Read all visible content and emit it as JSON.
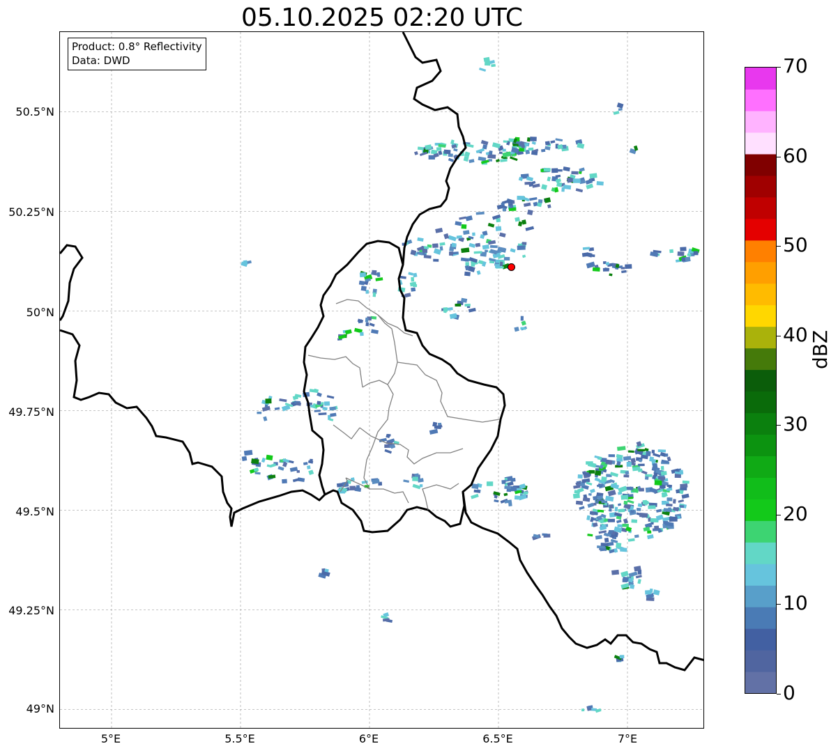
{
  "title": "05.10.2025 02:20 UTC",
  "info_box": {
    "product": "Product: 0.8° Reflectivity",
    "data": "Data: DWD"
  },
  "axes": {
    "lat_ticks": [
      "50.5°N",
      "50.25°N",
      "50°N",
      "49.75°N",
      "49.5°N",
      "49.25°N",
      "49°N"
    ],
    "lon_ticks": [
      "5°E",
      "5.5°E",
      "6°E",
      "6.5°E",
      "7°E"
    ],
    "extent": {
      "lon_min": 4.8,
      "lon_max": 7.3,
      "lat_min": 48.95,
      "lat_max": 50.7
    },
    "grid": true
  },
  "colorbar": {
    "label": "dBZ",
    "min": 0,
    "max": 70,
    "tick_labels": [
      "0",
      "10",
      "20",
      "30",
      "40",
      "50",
      "60",
      "70"
    ],
    "colors": [
      "#6271a6",
      "#5065a0",
      "#4260a2",
      "#4a7bb5",
      "#589fca",
      "#66c4dd",
      "#62d7c6",
      "#3dd472",
      "#13c91a",
      "#11bd1a",
      "#10aa15",
      "#0c9310",
      "#0b800e",
      "#0a6b0a",
      "#0b5d0a",
      "#457a0a",
      "#aab20b",
      "#ffd700",
      "#ffbb00",
      "#ff9f00",
      "#ff8000",
      "#e40000",
      "#c00000",
      "#a00000",
      "#800000",
      "#ffe0ff",
      "#ffb3ff",
      "#ff70ff",
      "#e838ee"
    ]
  },
  "radar_site": {
    "lon": 6.55,
    "lat": 50.11,
    "color": "#ff0000"
  }
}
